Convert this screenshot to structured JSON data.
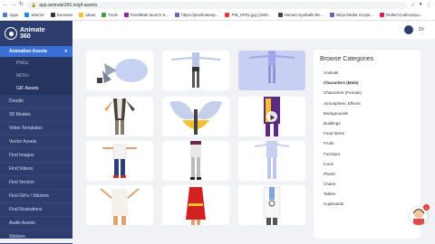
{
  "browser": {
    "url": "app.animate360.io/gif-assets",
    "bookmarks": [
      {
        "label": "Apps",
        "color": "#4a7bd0"
      },
      {
        "label": "Warrior",
        "color": "#1e88e5"
      },
      {
        "label": "Bonuses",
        "color": "#333333"
      },
      {
        "label": "Ideas",
        "color": "#fbc02d"
      },
      {
        "label": "Tools",
        "color": "#43a047"
      },
      {
        "label": "PixelMate launch S...",
        "color": "#8e24aa"
      },
      {
        "label": "https://pixelmatesp...",
        "color": "#5c6bc0"
      },
      {
        "label": "PM_SP01.jpg (1920...",
        "color": "#e53935"
      },
      {
        "label": "Human Eyeballs Be...",
        "color": "#444444"
      },
      {
        "label": "Ninja Media Scripti...",
        "color": "#7e57c2"
      },
      {
        "label": "Nulled Codecanyo...",
        "color": "#d81b60"
      }
    ]
  },
  "sidebar": {
    "logo_line1": "Animate",
    "logo_line2": "360",
    "active_section": "Animation Assets",
    "sub_items": [
      "PNGs",
      "MOVs",
      "GIF Assets"
    ],
    "items": [
      "Doodle",
      "3D Models",
      "Video Templates",
      "Vector Assets",
      "Find Images",
      "Find Videos",
      "Find Vectors",
      "Find GIFs / Stickers",
      "Find Illustrations",
      "Audio Assets",
      "Stickers"
    ]
  },
  "topbar": {
    "user_initials": "2V"
  },
  "categories": {
    "title": "Browse Categories",
    "items": [
      "Animals",
      "Characters (Male)",
      "Characters (Female)",
      "Atmospheric Effects",
      "Backgrounds",
      "Buildings",
      "Food Items",
      "Fruits",
      "Furniture",
      "Icons",
      "Plants",
      "Chairs",
      "Tables",
      "Cupboards"
    ],
    "active": "Characters (Male)"
  },
  "chat": {
    "badge": "1"
  },
  "colors": {
    "sidebar": "#2d3e6e",
    "accent": "#3a6fd8",
    "highlight_card": "#c9cff3"
  }
}
